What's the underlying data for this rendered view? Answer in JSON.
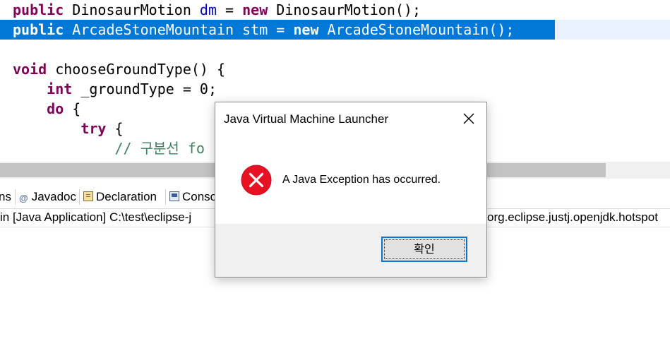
{
  "editor": {
    "lines": [
      {
        "tokens": [
          {
            "t": "public",
            "c": "kw"
          },
          {
            "t": " DinosaurMotion ",
            "c": ""
          },
          {
            "t": "dm",
            "c": "fld"
          },
          {
            "t": " = ",
            "c": ""
          },
          {
            "t": "new",
            "c": "kw"
          },
          {
            "t": " DinosaurMotion();",
            "c": ""
          }
        ]
      },
      {
        "tokens": [
          {
            "t": "public",
            "c": "kw"
          },
          {
            "t": " ArcadeStoneMountain ",
            "c": ""
          },
          {
            "t": "stm",
            "c": "fld"
          },
          {
            "t": " = ",
            "c": ""
          },
          {
            "t": "new",
            "c": "kw"
          },
          {
            "t": " ArcadeStoneMountain();",
            "c": ""
          }
        ],
        "selected": true
      },
      {
        "tokens": []
      },
      {
        "tokens": [
          {
            "t": "void",
            "c": "kw"
          },
          {
            "t": " chooseGroundType() {",
            "c": ""
          }
        ]
      },
      {
        "tokens": [
          {
            "t": "    ",
            "c": ""
          },
          {
            "t": "int",
            "c": "kw"
          },
          {
            "t": " _groundType = 0;",
            "c": ""
          }
        ]
      },
      {
        "tokens": [
          {
            "t": "    ",
            "c": ""
          },
          {
            "t": "do",
            "c": "kw"
          },
          {
            "t": " {",
            "c": ""
          }
        ]
      },
      {
        "tokens": [
          {
            "t": "        ",
            "c": ""
          },
          {
            "t": "try",
            "c": "kw"
          },
          {
            "t": " {",
            "c": ""
          }
        ]
      },
      {
        "tokens": [
          {
            "t": "            ",
            "c": ""
          },
          {
            "t": "// 구분선 fo",
            "c": "cmt"
          }
        ]
      }
    ]
  },
  "panel": {
    "tabs": [
      {
        "label": "ns",
        "icon": ""
      },
      {
        "label": "Javadoc",
        "icon": "at-icon"
      },
      {
        "label": "Declaration",
        "icon": "declaration-icon"
      },
      {
        "label": "Conso",
        "icon": "console-icon"
      }
    ],
    "console_left": "in [Java Application] C:\\test\\eclipse-j",
    "console_right": "org.eclipse.justj.openjdk.hotspot"
  },
  "dialog": {
    "title": "Java Virtual Machine Launcher",
    "message": "A Java Exception has occurred.",
    "ok_label": "확인",
    "icon": "error-icon"
  },
  "colors": {
    "selection": "#0078d7",
    "keyword": "#7f0055",
    "field": "#0000c0",
    "comment": "#3f7f5f",
    "error": "#e81123"
  }
}
